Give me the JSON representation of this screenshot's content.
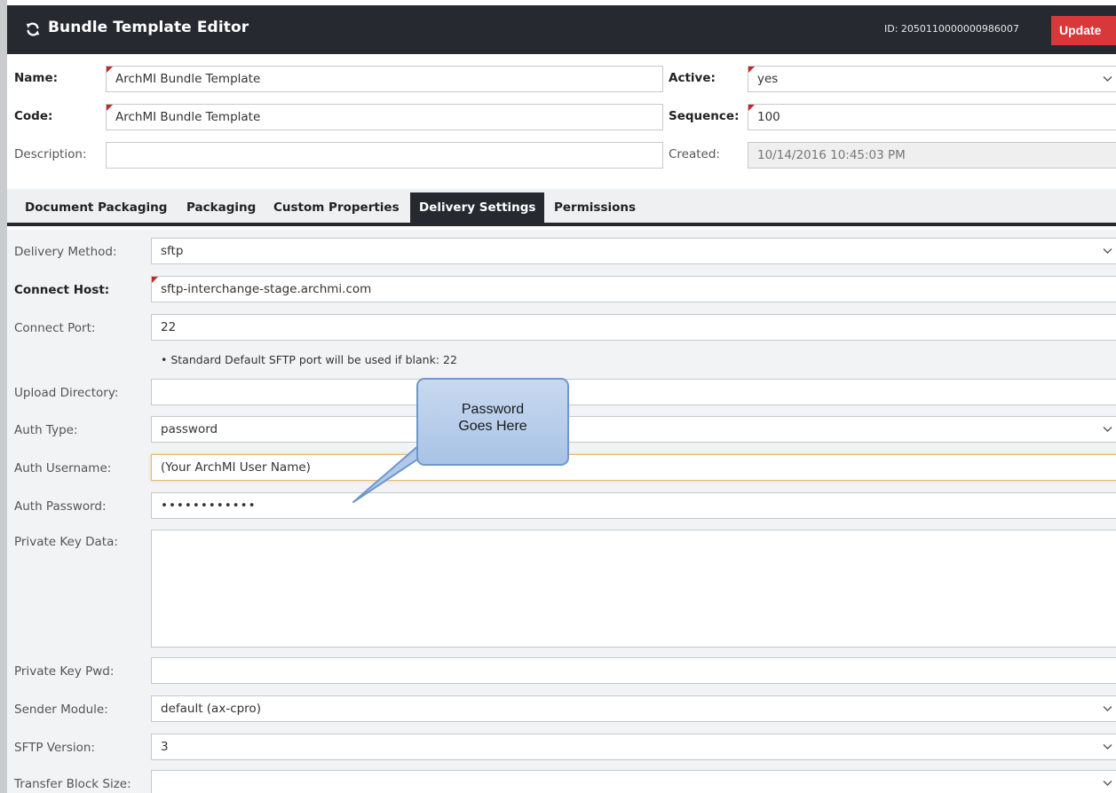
{
  "header": {
    "title": "Bundle Template Editor",
    "record_id": "ID: 2050110000000986007",
    "update_label": "Update"
  },
  "top_fields": {
    "name_label": "Name:",
    "name_value": "ArchMI Bundle Template",
    "code_label": "Code:",
    "code_value": "ArchMI Bundle Template",
    "description_label": "Description:",
    "description_value": "",
    "active_label": "Active:",
    "active_value": "yes",
    "sequence_label": "Sequence:",
    "sequence_value": "100",
    "created_label": "Created:",
    "created_value": "10/14/2016 10:45:03 PM"
  },
  "tabs": [
    {
      "label": "Document Packaging",
      "active": false
    },
    {
      "label": "Packaging",
      "active": false
    },
    {
      "label": "Custom Properties",
      "active": false
    },
    {
      "label": "Delivery Settings",
      "active": true
    },
    {
      "label": "Permissions",
      "active": false
    }
  ],
  "delivery": {
    "delivery_method_label": "Delivery Method:",
    "delivery_method_value": "sftp",
    "connect_host_label": "Connect Host:",
    "connect_host_value": "sftp-interchange-stage.archmi.com",
    "connect_port_label": "Connect Port:",
    "connect_port_value": "22",
    "port_hint": "• Standard Default SFTP port will be used if blank: 22",
    "upload_directory_label": "Upload Directory:",
    "upload_directory_value": "",
    "auth_type_label": "Auth Type:",
    "auth_type_value": "password",
    "auth_username_label": "Auth Username:",
    "auth_username_value": "(Your ArchMI User Name)",
    "auth_password_label": "Auth Password:",
    "auth_password_value": "••••••••••••",
    "private_key_data_label": "Private Key Data:",
    "private_key_data_value": "",
    "private_key_pwd_label": "Private Key Pwd:",
    "private_key_pwd_value": "",
    "sender_module_label": "Sender Module:",
    "sender_module_value": "default (ax-cpro)",
    "sftp_version_label": "SFTP Version:",
    "sftp_version_value": "3",
    "transfer_block_size_label": "Transfer Block Size:",
    "transfer_block_size_value": ""
  },
  "callout": {
    "text_line1": "Password",
    "text_line2": "Goes Here"
  },
  "colors": {
    "header_bg": "#262a30",
    "update_button": "#d9383b",
    "required_marker": "#c22a2a",
    "callout_fill": "#b8cfec",
    "callout_border": "#6f97cc"
  }
}
